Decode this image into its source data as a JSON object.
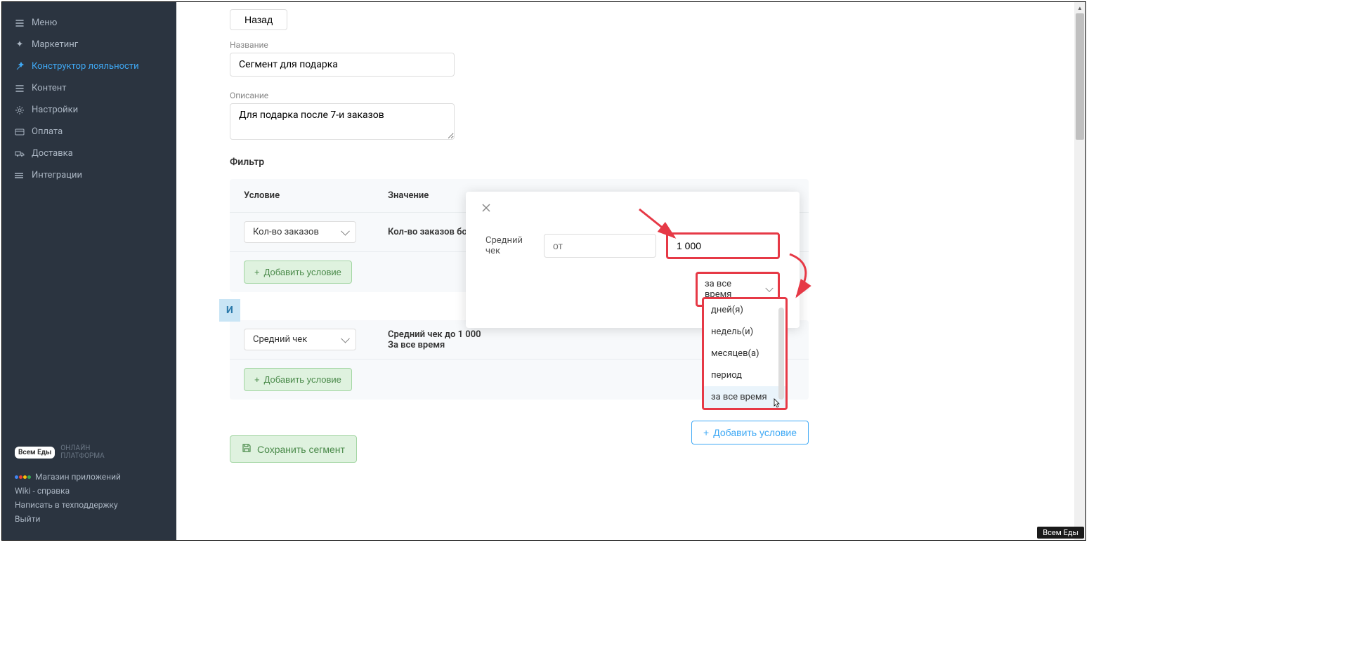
{
  "sidebar": {
    "items": [
      {
        "label": "Меню",
        "icon": "list"
      },
      {
        "label": "Маркетинг",
        "icon": "sparkle"
      },
      {
        "label": "Конструктор лояльности",
        "icon": "wand",
        "active": true
      },
      {
        "label": "Контент",
        "icon": "list"
      },
      {
        "label": "Настройки",
        "icon": "gear"
      },
      {
        "label": "Оплата",
        "icon": "card"
      },
      {
        "label": "Доставка",
        "icon": "truck"
      },
      {
        "label": "Интеграции",
        "icon": "integration"
      }
    ],
    "logo_badge": "Всем Еды",
    "logo_sub": "ОНЛАЙН\nПЛАТФОРМА",
    "links": [
      "Магазин приложений",
      "Wiki - справка",
      "Написать в техподдержку",
      "Выйти"
    ]
  },
  "form": {
    "back": "Назад",
    "name_label": "Название",
    "name_value": "Сегмент для подарка",
    "desc_label": "Описание",
    "desc_value": "Для подарка после 7-и заказов",
    "filter_title": "Фильтр"
  },
  "filter": {
    "header_condition": "Условие",
    "header_value": "Значение",
    "rows": [
      {
        "condition": "Кол-во заказов",
        "value": "Кол-во заказов больш"
      },
      {
        "condition": "Средний чек",
        "value_line1": "Средний чек до 1 000",
        "value_line2": "За все время"
      }
    ],
    "add_btn": "Добавить условие",
    "and_label": "И",
    "add_outline": "Добавить условие",
    "save": "Сохранить сегмент"
  },
  "popover": {
    "label": "Средний чек",
    "from_placeholder": "от",
    "to_value": "1 000",
    "select": "за все время"
  },
  "dropdown": {
    "items": [
      "дней(я)",
      "недель(и)",
      "месяцев(а)",
      "период",
      "за все время"
    ],
    "selected": "за все время"
  },
  "footer_badge": "Всем Еды"
}
